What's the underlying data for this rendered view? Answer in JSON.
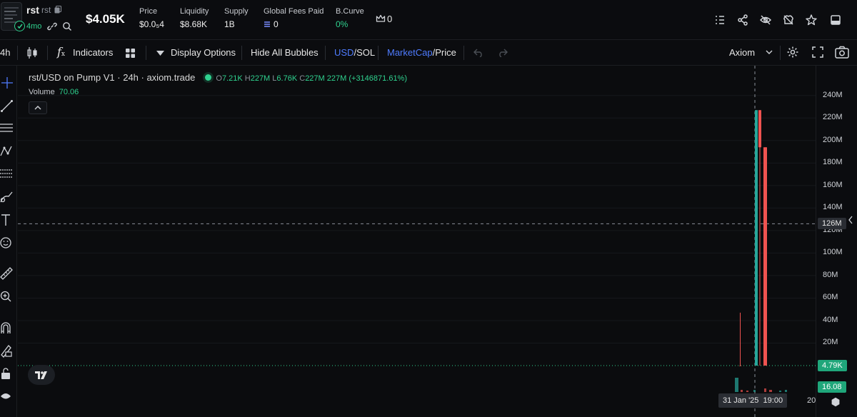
{
  "token": {
    "symbol": "rst",
    "name": "rst",
    "age": "4mo",
    "market_cap": "$4.05K"
  },
  "stats": {
    "price_label": "Price",
    "price_value": "$0.0₅4",
    "liquidity_label": "Liquidity",
    "liquidity_value": "$8.68K",
    "supply_label": "Supply",
    "supply_value": "1B",
    "fees_label": "Global Fees Paid",
    "fees_value": "0",
    "bcurve_label": "B.Curve",
    "bcurve_value": "0%",
    "crown_value": "0"
  },
  "toolbar": {
    "interval": "4h",
    "indicators": "Indicators",
    "display_options": "Display Options",
    "hide_bubbles": "Hide All Bubbles",
    "usd": "USD",
    "sol": "/SOL",
    "marketcap": "MarketCap",
    "price": "/Price",
    "source": "Axiom"
  },
  "legend": {
    "title": "rst/USD on Pump V1 · 24h · axiom.trade",
    "o_label": "O",
    "o_value": "7.21K",
    "h_label": "H",
    "h_value": "227M",
    "l_label": "L",
    "l_value": "6.76K",
    "c_label": "C",
    "c_value": "227M",
    "change": "227M (+3146871.61%)",
    "volume_label": "Volume",
    "volume_value": "70.06"
  },
  "price_scale": {
    "ticks": [
      "240M",
      "220M",
      "200M",
      "180M",
      "160M",
      "140M",
      "120M",
      "100M",
      "80M",
      "60M",
      "40M",
      "20M"
    ],
    "crosshair_label": "126M",
    "last_price_label": "4.79K",
    "volume_label": "16.08"
  },
  "time_scale": {
    "crosshair_date": "31 Jan '25",
    "crosshair_time": "19:00",
    "tick": "20"
  },
  "chart_data": {
    "type": "candlestick",
    "y_unit": "market cap USD",
    "ylim": [
      0,
      250000000
    ],
    "crosshair_y": 126000000,
    "last_price": 4790,
    "candles": [
      {
        "o": 4000,
        "h": 47000000,
        "l": 3000,
        "c": 4200,
        "dir": "down"
      },
      {
        "o": 7210,
        "h": 227000000,
        "l": 6760,
        "c": 227000000,
        "dir": "up"
      },
      {
        "o": 227000000,
        "h": 227000000,
        "l": 4000,
        "c": 194000000,
        "dir": "down"
      },
      {
        "o": 194000000,
        "h": 194000000,
        "l": 4790,
        "c": 4790,
        "dir": "down"
      }
    ]
  },
  "colors": {
    "up": "#26a69a",
    "down": "#ef5350",
    "accent_green": "#2fd28f",
    "accent_blue": "#4f7cff"
  }
}
